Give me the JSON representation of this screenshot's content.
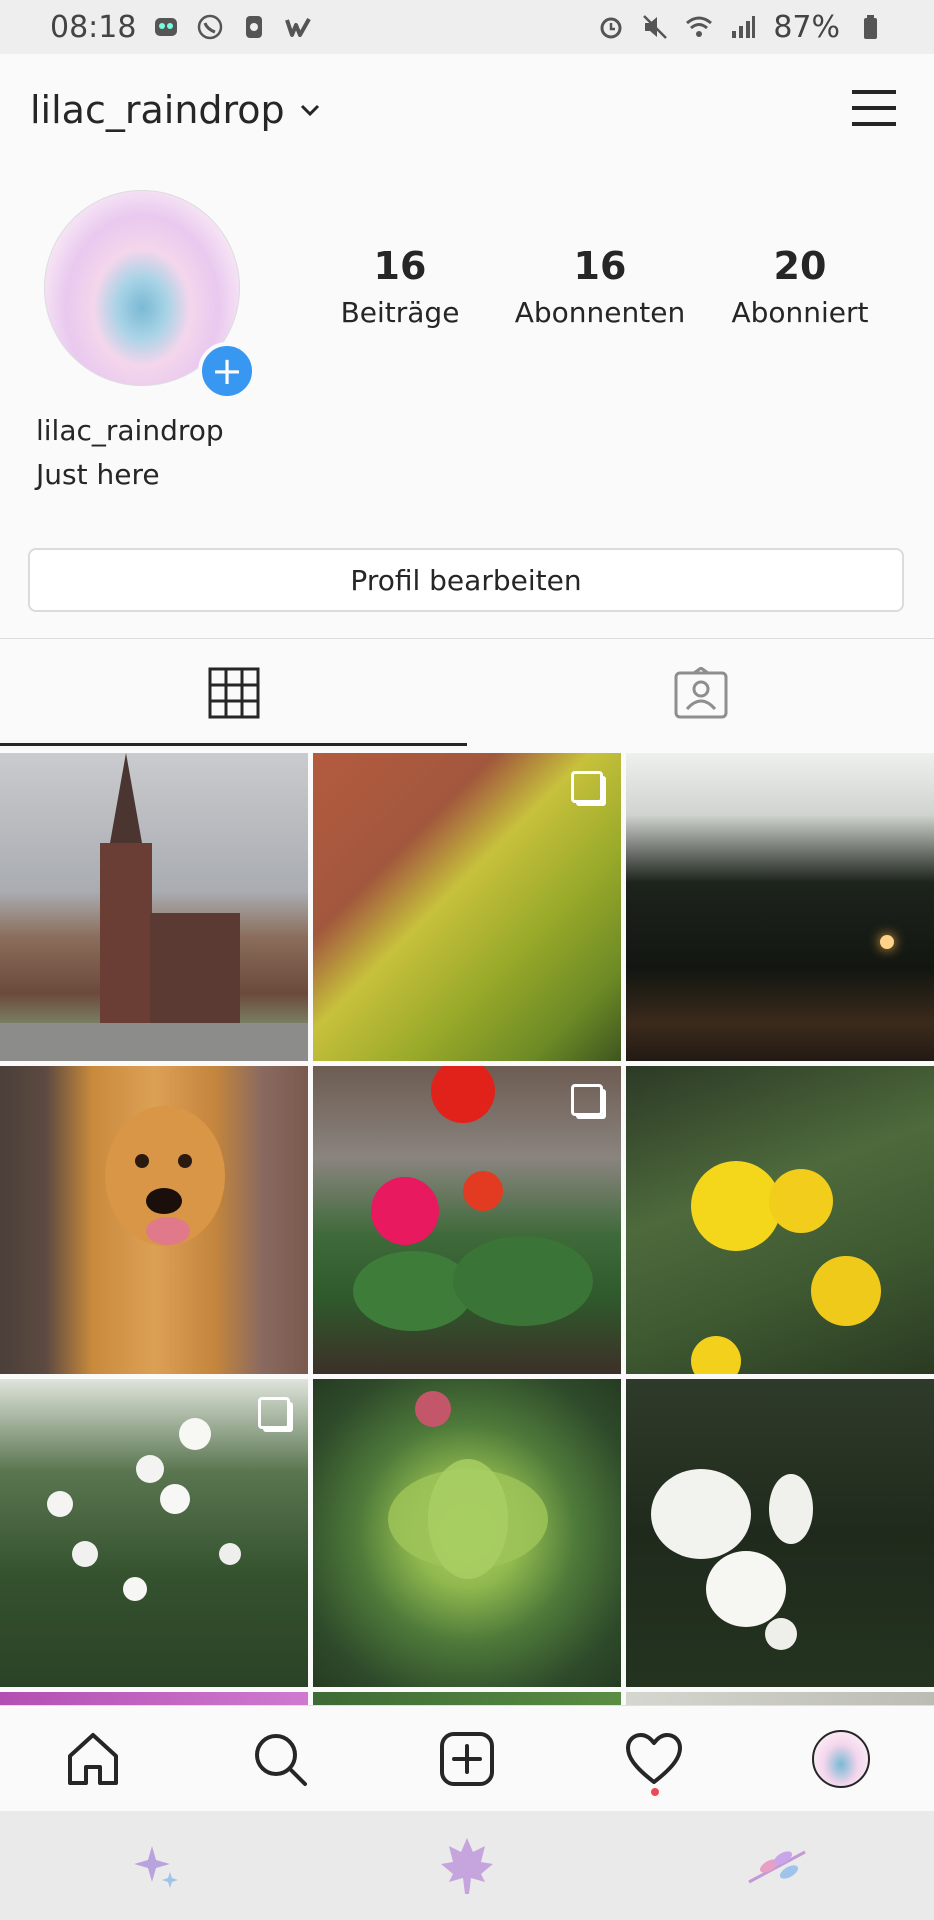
{
  "status": {
    "time": "08:18",
    "battery": "87%"
  },
  "header": {
    "username": "lilac_raindrop"
  },
  "profile": {
    "stats": [
      {
        "value": "16",
        "label": "Beiträge"
      },
      {
        "value": "16",
        "label": "Abonnenten"
      },
      {
        "value": "20",
        "label": "Abonniert"
      }
    ],
    "name": "lilac_raindrop",
    "bio": "Just here",
    "edit_label": "Profil bearbeiten"
  },
  "tabs": [
    {
      "icon": "grid-icon",
      "active": true
    },
    {
      "icon": "tagged-person-icon",
      "active": false
    }
  ],
  "posts": [
    {
      "subject": "church",
      "multi": false
    },
    {
      "subject": "yellow-tree-building",
      "multi": true
    },
    {
      "subject": "tree-silhouette",
      "multi": false
    },
    {
      "subject": "golden-retriever",
      "multi": false
    },
    {
      "subject": "red-pink-geraniums",
      "multi": true
    },
    {
      "subject": "yellow-flowers",
      "multi": false
    },
    {
      "subject": "white-flowers-bush",
      "multi": true
    },
    {
      "subject": "succulent",
      "multi": false
    },
    {
      "subject": "white-roses",
      "multi": false
    }
  ],
  "nav": [
    "home-icon",
    "search-icon",
    "new-post-icon",
    "activity-heart-icon",
    "profile-avatar-icon"
  ],
  "colors": {
    "accent_blue": "#3897f0",
    "notification_red": "#ed4956",
    "text": "#262626"
  }
}
